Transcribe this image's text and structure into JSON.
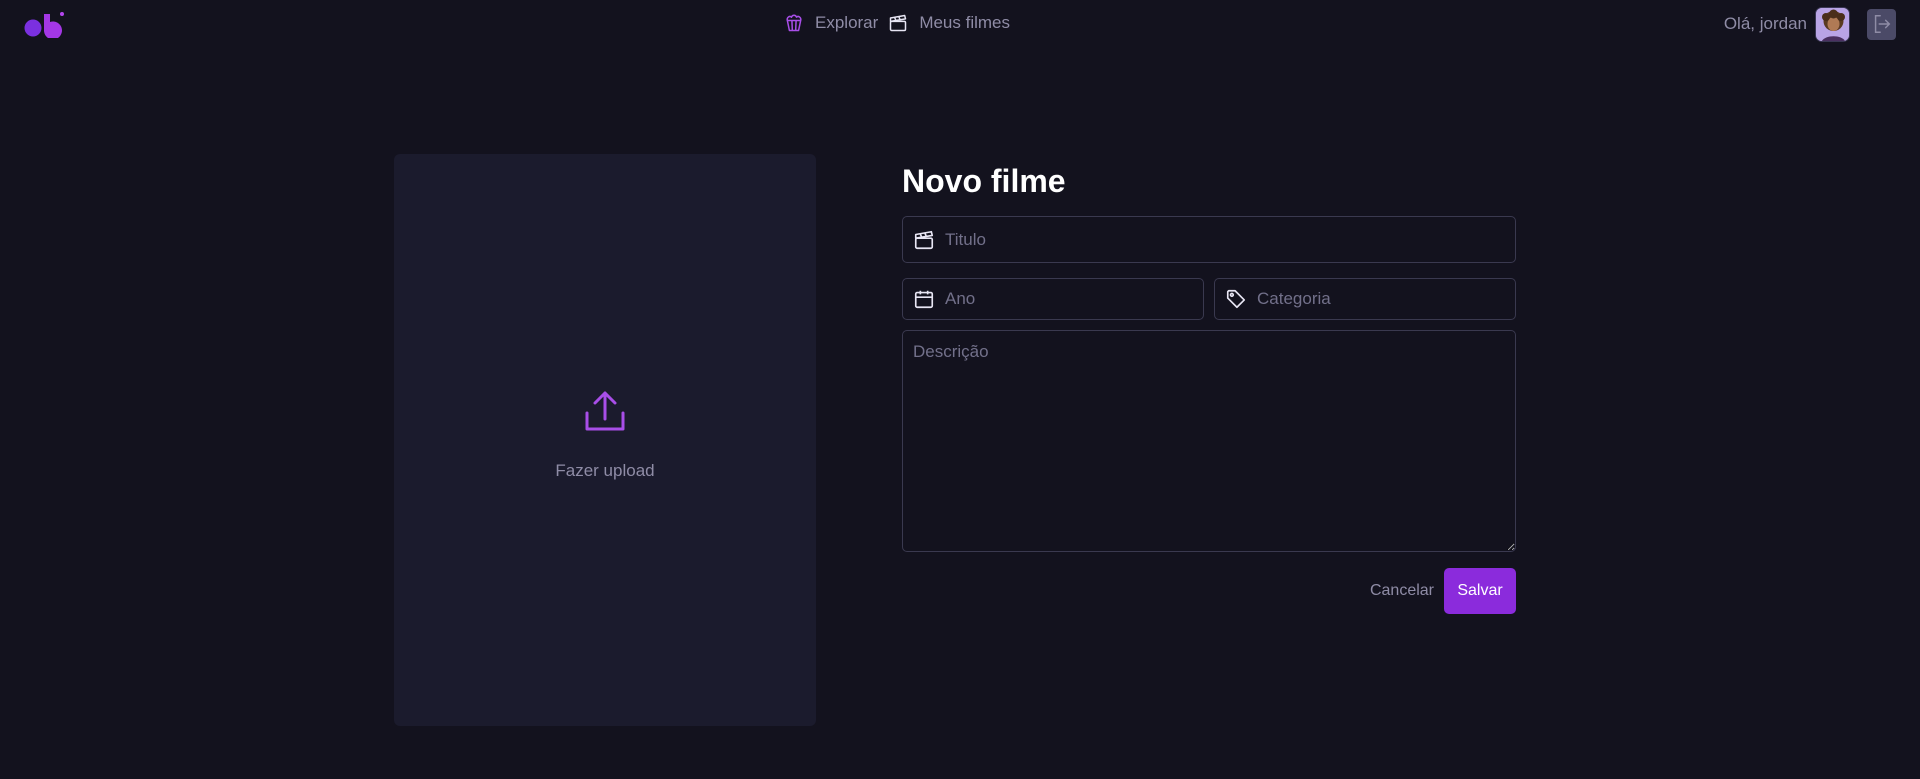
{
  "nav": {
    "explore_label": "Explorar",
    "my_movies_label": "Meus filmes"
  },
  "user": {
    "greeting": "Olá, jordan"
  },
  "upload": {
    "label": "Fazer upload"
  },
  "form": {
    "title": "Novo filme",
    "title_placeholder": "Titulo",
    "year_placeholder": "Ano",
    "category_placeholder": "Categoria",
    "description_placeholder": "Descrição",
    "cancel_label": "Cancelar",
    "save_label": "Salvar"
  },
  "colors": {
    "background": "#13121e",
    "panel": "#1b1b2d",
    "accent": "#8b2bdc",
    "text_muted": "#8f8ca6"
  }
}
